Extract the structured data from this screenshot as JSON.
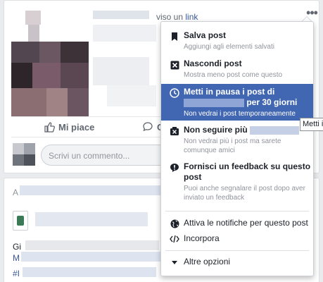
{
  "post": {
    "header_text": "viso un",
    "header_link": "link",
    "like_label": "Mi piace",
    "comment_label": "Co",
    "comment_placeholder": "Scrivi un commento..."
  },
  "post2": {
    "letter": "A",
    "g": "Gi",
    "m": "M",
    "hash": "#I"
  },
  "menu": {
    "items": [
      {
        "title": "Salva post",
        "sub": "Aggiungi agli elementi salvati",
        "icon": "bookmark-icon"
      },
      {
        "title": "Nascondi post",
        "sub": "Mostra meno post come questo",
        "icon": "hide-icon"
      },
      {
        "title_1": "Metti in pausa i post di",
        "title_2": "per 30 giorni",
        "sub": "Non vedrai i post temporaneamente",
        "icon": "clock-icon"
      },
      {
        "title": "Non seguire più",
        "sub": "Non vedrai più i post ma sarete comunque amici",
        "icon": "unfollow-icon"
      },
      {
        "title": "Fornisci un feedback su questo post",
        "sub": "Puoi anche segnalare il post dopo aver inviato un feedback",
        "icon": "feedback-icon"
      },
      {
        "title": "Attiva le notifiche per questo post",
        "icon": "globe-icon"
      },
      {
        "title": "Incorpora",
        "icon": "code-icon"
      },
      {
        "title": "Altre opzioni",
        "icon": "caret-down-icon"
      }
    ]
  },
  "tooltip": "Metti i",
  "colors": {
    "accent": "#4267b2",
    "link": "#385898",
    "background": "#e9ebee"
  }
}
